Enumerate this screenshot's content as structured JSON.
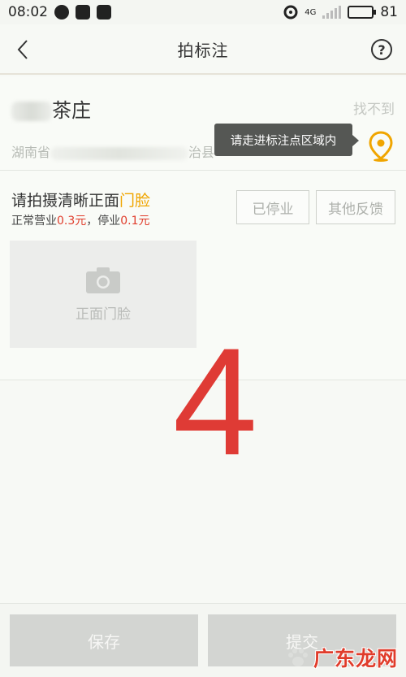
{
  "status_bar": {
    "time": "08:02",
    "network": "4G",
    "battery": "81",
    "battery_level": 0.81
  },
  "nav": {
    "title": "拍标注",
    "help_symbol": "?"
  },
  "poi": {
    "name_suffix": "茶庄",
    "not_found": "找不到",
    "address_prefix": "湖南省",
    "address_suffix": "治县",
    "tooltip": "请走进标注点区域内"
  },
  "photo": {
    "title_prefix": "请拍摄清晰正面",
    "title_highlight": "门脸",
    "price_a_label": "正常营业",
    "price_a_value": "0.3元",
    "price_sep": "，停业",
    "price_b_value": "0.1元",
    "closed_button": "已停业",
    "feedback_button": "其他反馈",
    "placeholder_label": "正面门脸"
  },
  "overlay_number": "4",
  "actions": {
    "save": "保存",
    "submit": "提交"
  },
  "watermark": {
    "text": "广东龙网"
  },
  "colors": {
    "accent_orange": "#f0a500",
    "price_red": "#e03c2b",
    "overlay_red": "#df3b35",
    "tooltip_bg": "#555754"
  }
}
